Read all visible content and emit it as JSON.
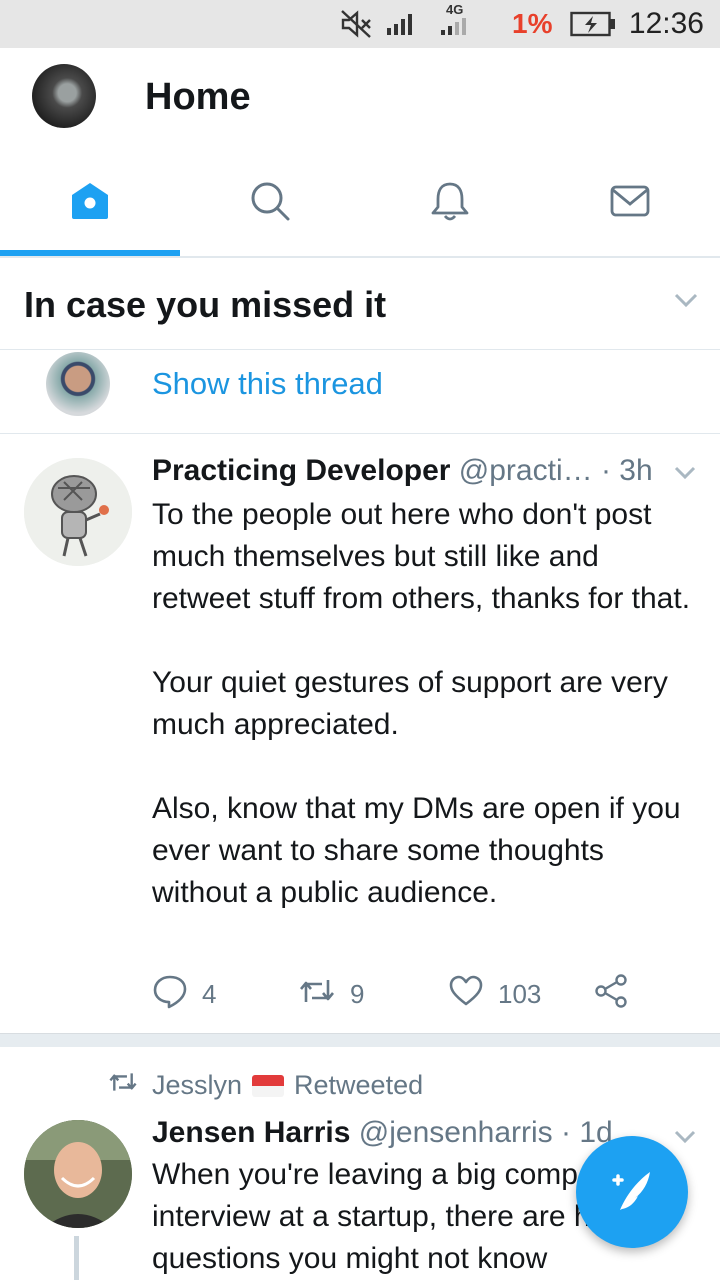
{
  "status_bar": {
    "time": "12:36",
    "battery_percent": "1%",
    "network": "4G",
    "icons": [
      "mute-icon",
      "signal-icon",
      "signal-4g-icon",
      "battery-charging-icon"
    ]
  },
  "header": {
    "title": "Home"
  },
  "tabs": [
    {
      "name": "home",
      "icon": "home-icon",
      "active": true
    },
    {
      "name": "search",
      "icon": "search-icon",
      "active": false
    },
    {
      "name": "notifications",
      "icon": "bell-icon",
      "active": false
    },
    {
      "name": "messages",
      "icon": "envelope-icon",
      "active": false
    }
  ],
  "section": {
    "title": "In case you missed it"
  },
  "thread": {
    "label": "Show this thread"
  },
  "tweets": [
    {
      "name": "Practicing Developer",
      "handle": "@practi…",
      "time": " · 3h",
      "paragraphs": [
        "To the people out here who don't post much themselves but still like and retweet stuff from others, thanks for that.",
        "Your quiet gestures of support are very much appreciated.",
        "Also, know that my DMs are open if you ever want to share some thoughts without a public audience."
      ],
      "replies": "4",
      "retweets": "9",
      "likes": "103"
    },
    {
      "retweeted_by": "Jesslyn",
      "retweeted_label": "Retweeted",
      "name": "Jensen Harris",
      "handle": "@jensenharris",
      "time": " · 1d",
      "text": "When you're leaving a big company to interview at a startup, there are hidden questions you might not know"
    }
  ],
  "colors": {
    "accent": "#1da1f2",
    "link": "#1b95e0",
    "muted": "#657786",
    "battery_low": "#e8402b"
  },
  "fab": {
    "icon": "compose-tweet-icon"
  }
}
